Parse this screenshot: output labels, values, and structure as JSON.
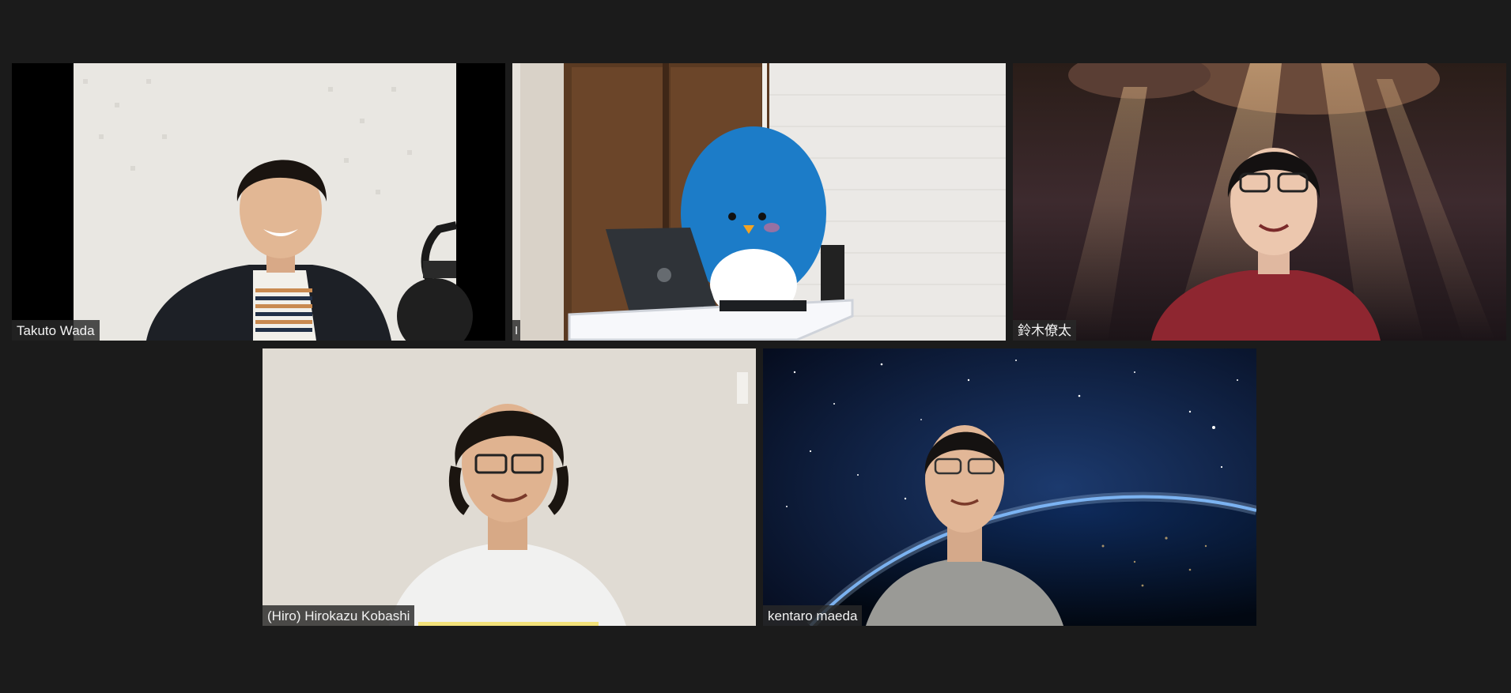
{
  "meeting": {
    "layout": "gallery",
    "participants": [
      {
        "name": "Takuto Wada",
        "video": "on"
      },
      {
        "name": "I",
        "video": "virtual-background"
      },
      {
        "name": "鈴木僚太",
        "video": "on"
      },
      {
        "name": "(Hiro) Hirokazu Kobashi",
        "video": "on",
        "speaking": true
      },
      {
        "name": "kentaro maeda",
        "video": "on"
      }
    ],
    "active_speaker_indicator_color": "#f3e27a"
  },
  "colors": {
    "window_background": "#1b1b1b",
    "label_background": "#282828",
    "label_text": "#f2f2f2"
  }
}
